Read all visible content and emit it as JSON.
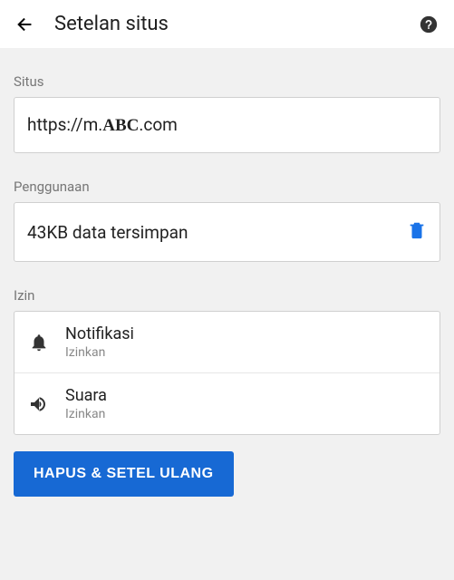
{
  "header": {
    "title": "Setelan situs"
  },
  "labels": {
    "site": "Situs",
    "usage": "Penggunaan",
    "perms": "Izin"
  },
  "site": {
    "prefix": "https://m.",
    "domain": "ABC",
    "suffix": ".com"
  },
  "usage": {
    "text": "43KB data tersimpan"
  },
  "permissions": [
    {
      "title": "Notifikasi",
      "status": "Izinkan",
      "icon": "bell"
    },
    {
      "title": "Suara",
      "status": "Izinkan",
      "icon": "sound"
    }
  ],
  "reset_label": "HAPUS & SETEL ULANG"
}
